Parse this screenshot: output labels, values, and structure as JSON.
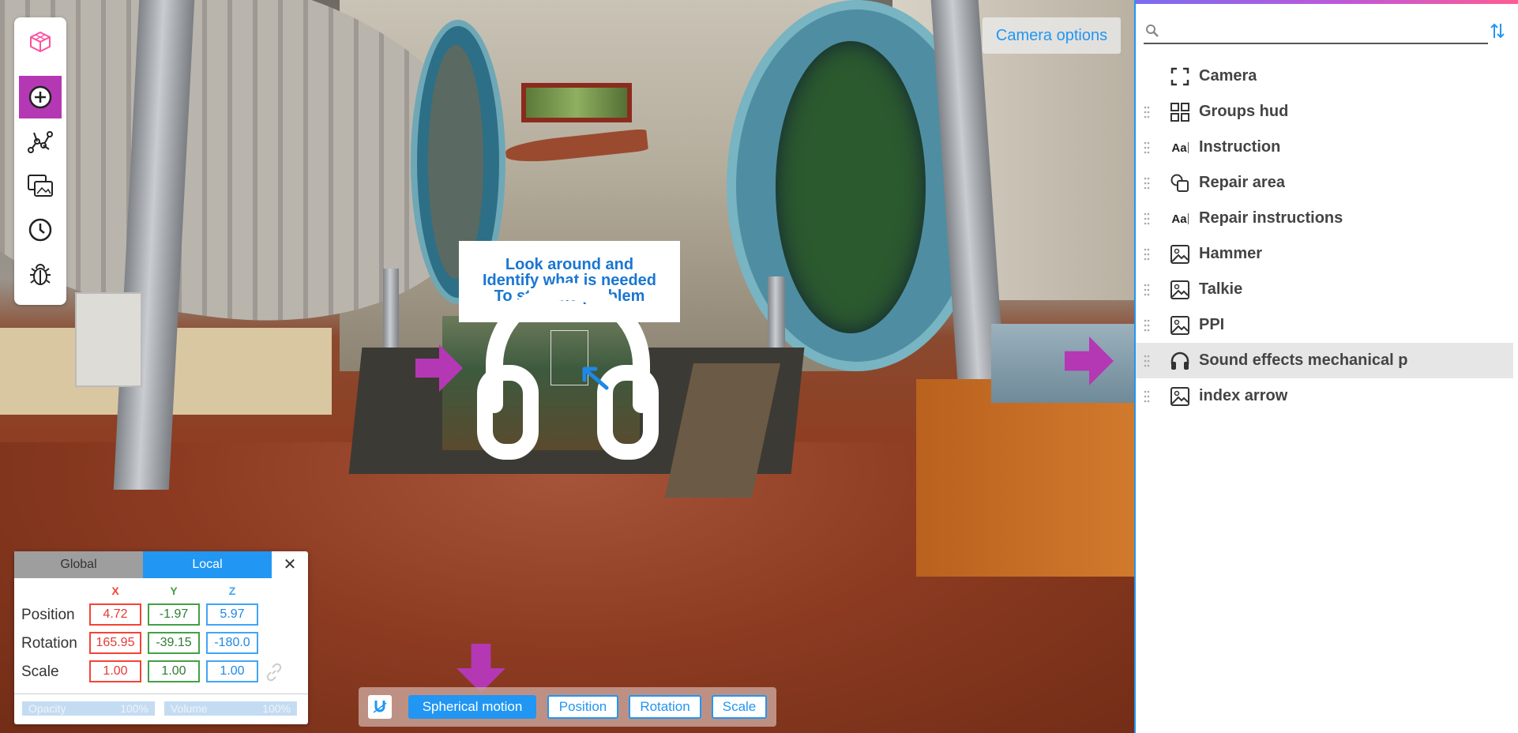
{
  "scene": {
    "instruction_lines": [
      "Look around and",
      "Identify what is needed",
      "To stop the problem"
    ],
    "camera_options_label": "Camera options"
  },
  "toolbar": {
    "tools": [
      {
        "name": "cube-logo-icon",
        "active": false
      },
      {
        "name": "add-circle-icon",
        "active": true
      },
      {
        "name": "graph-nodes-icon",
        "active": false
      },
      {
        "name": "media-gallery-icon",
        "active": false
      },
      {
        "name": "clock-icon",
        "active": false
      },
      {
        "name": "bug-icon",
        "active": false
      }
    ]
  },
  "transform": {
    "tabs": [
      "Global",
      "Local"
    ],
    "active_tab": "Local",
    "close_label": "✕",
    "axes": [
      "X",
      "Y",
      "Z"
    ],
    "rows": [
      {
        "label": "Position",
        "x": "4.72",
        "y": "-1.97",
        "z": "5.97"
      },
      {
        "label": "Rotation",
        "x": "165.95",
        "y": "-39.15",
        "z": "-180.0"
      },
      {
        "label": "Scale",
        "x": "1.00",
        "y": "1.00",
        "z": "1.00"
      }
    ],
    "footer": [
      {
        "label": "Opacity",
        "value": "100%"
      },
      {
        "label": "Volume",
        "value": "100%"
      }
    ],
    "colors": {
      "x": "#f44336",
      "y": "#43a047",
      "z": "#42a5f5"
    }
  },
  "modebar": {
    "buttons": [
      "Spherical motion",
      "Position",
      "Rotation",
      "Scale"
    ],
    "active": "Spherical motion"
  },
  "sidebar": {
    "search": {
      "placeholder": "",
      "value": ""
    },
    "items": [
      {
        "label": "Camera",
        "icon": "frame-corners-icon",
        "draggable": false,
        "selected": false
      },
      {
        "label": "Groups hud",
        "icon": "grid-icon",
        "draggable": true,
        "selected": false
      },
      {
        "label": "Instruction",
        "icon": "text-icon",
        "draggable": true,
        "selected": false
      },
      {
        "label": "Repair area",
        "icon": "shapes-icon",
        "draggable": true,
        "selected": false
      },
      {
        "label": "Repair instructions",
        "icon": "text-icon",
        "draggable": true,
        "selected": false
      },
      {
        "label": "Hammer",
        "icon": "image-icon",
        "draggable": true,
        "selected": false
      },
      {
        "label": "Talkie",
        "icon": "image-icon",
        "draggable": true,
        "selected": false
      },
      {
        "label": "PPI",
        "icon": "image-icon",
        "draggable": true,
        "selected": false
      },
      {
        "label": "Sound effects mechanical p",
        "icon": "headphones-icon",
        "draggable": true,
        "selected": true
      },
      {
        "label": "index arrow",
        "icon": "image-icon",
        "draggable": true,
        "selected": false
      }
    ],
    "text_icon_glyph": "Aa"
  },
  "accent_color": "#2196f3",
  "highlight_color": "#b438b4"
}
